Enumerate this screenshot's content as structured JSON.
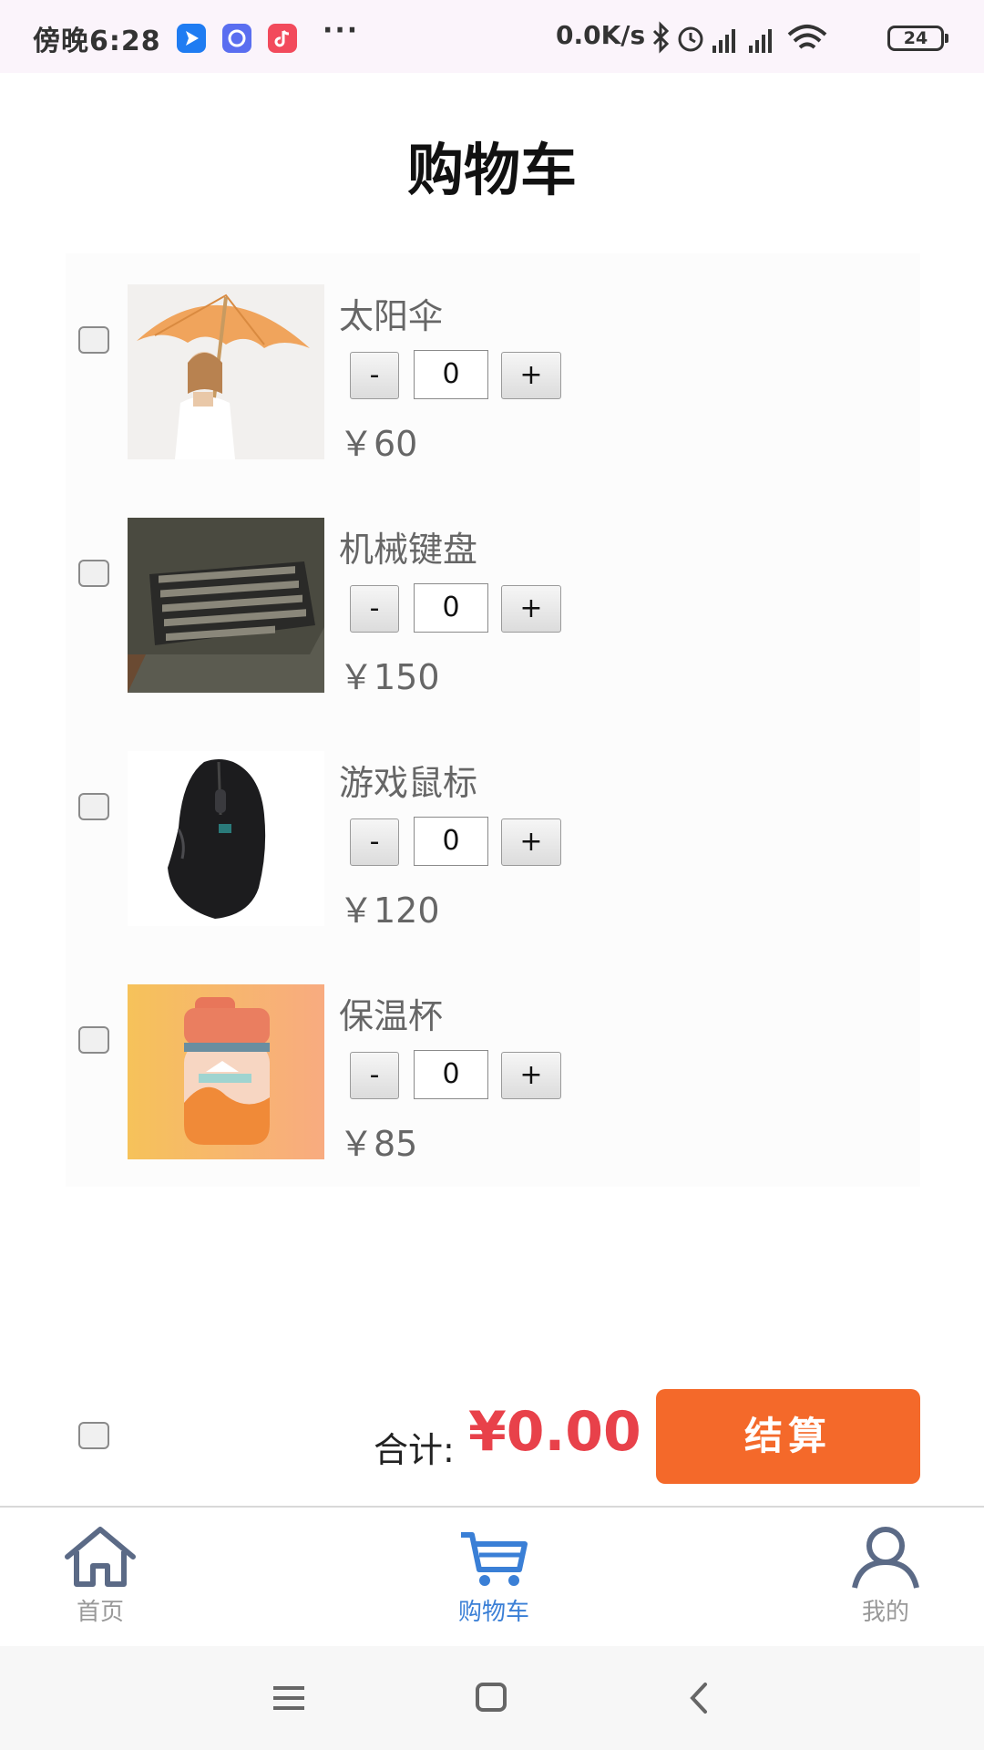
{
  "status_bar": {
    "time": "傍晚6:28",
    "more": "···",
    "speed": "0.0K/s",
    "battery": "24"
  },
  "page": {
    "title": "购物车"
  },
  "cart": {
    "items": [
      {
        "name": "太阳伞",
        "quantity": "0",
        "price": "￥60",
        "minus_label": "-",
        "plus_label": "+"
      },
      {
        "name": "机械键盘",
        "quantity": "0",
        "price": "￥150",
        "minus_label": "-",
        "plus_label": "+"
      },
      {
        "name": "游戏鼠标",
        "quantity": "0",
        "price": "￥120",
        "minus_label": "-",
        "plus_label": "+"
      },
      {
        "name": "保温杯",
        "quantity": "0",
        "price": "￥85",
        "minus_label": "-",
        "plus_label": "+"
      }
    ]
  },
  "footer": {
    "total_label": "合计:",
    "total_value": "¥0.00",
    "checkout_label": "结算"
  },
  "tabs": [
    {
      "label": "首页",
      "icon": "home-icon"
    },
    {
      "label": "购物车",
      "icon": "cart-icon",
      "active": true
    },
    {
      "label": "我的",
      "icon": "user-icon"
    }
  ],
  "colors": {
    "accent": "#3a7fd6",
    "checkout": "#f4692a",
    "total": "#e8414a"
  }
}
